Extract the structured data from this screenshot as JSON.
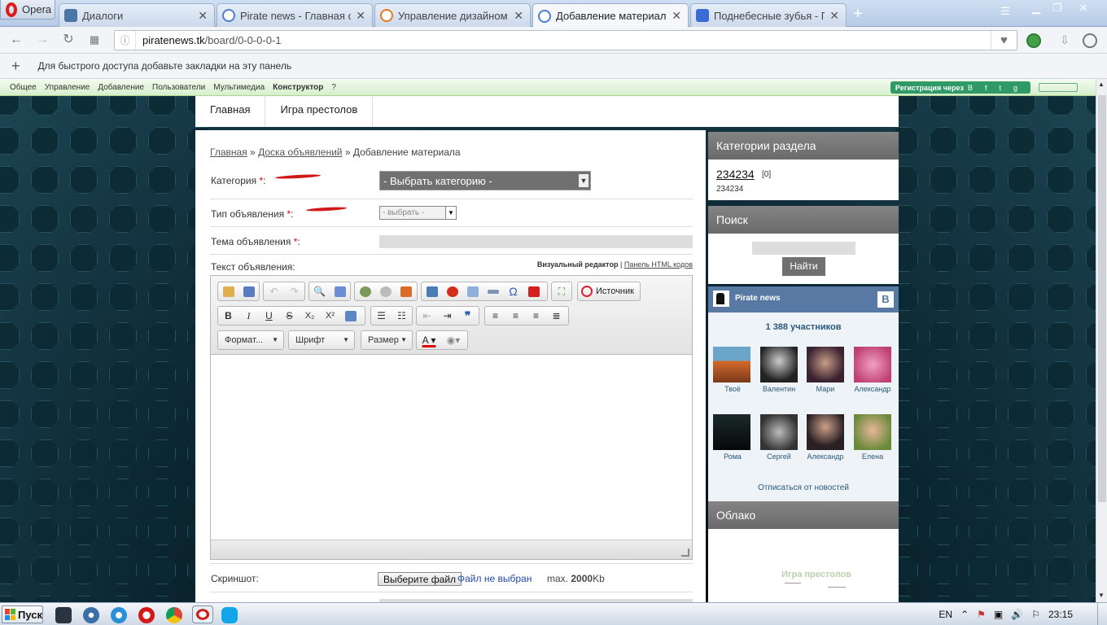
{
  "browser": {
    "menu_label": "Opera",
    "tabs": [
      {
        "title": "Диалоги",
        "active": false
      },
      {
        "title": "Pirate news - Главная стр",
        "active": false
      },
      {
        "title": "Управление дизайном - Г",
        "active": false
      },
      {
        "title": "Добавление материала -",
        "active": true
      },
      {
        "title": "Поднебесные зубья - По",
        "active": false
      }
    ],
    "url_host": "piratenews.tk",
    "url_path": "/board/0-0-0-0-1",
    "bookmarks_hint": "Для быстрого доступа добавьте закладки на эту панель"
  },
  "ucoz_panel": {
    "items": [
      "Общее",
      "Управление",
      "Добавление",
      "Пользователи",
      "Мультимедиа",
      "Конструктор",
      "?"
    ],
    "register_label": "Регистрация через"
  },
  "site_nav": [
    "Главная",
    "Игра престолов"
  ],
  "breadcrumb": {
    "home": "Главная",
    "sep": "»",
    "board": "Доска объявлений",
    "current": "Добавление материала"
  },
  "form": {
    "category_label": "Категория",
    "category_value": "- Выбрать категорию -",
    "type_label": "Тип объявления",
    "type_value": "- выбрать -",
    "topic_label": "Тема объявления",
    "text_label": "Текст объявления:",
    "visual_editor": "Визуальный редактор",
    "editor_sep": "|",
    "html_panel": "Панель HTML кодов",
    "source_label": "Источник",
    "format_label": "Формат...",
    "font_label": "Шрифт",
    "size_label": "Размер",
    "screenshot_label": "Скриншот:",
    "file_button": "Выберите файл",
    "file_status": "Файл не выбран",
    "max_prefix": "max.",
    "max_value": "2000",
    "max_unit": "Kb",
    "required_mark": "*",
    "colon": ":"
  },
  "sidebar": {
    "categories_title": "Категории раздела",
    "category_link": "234234",
    "category_count": "[0]",
    "category_sub": "234234",
    "search_title": "Поиск",
    "search_button": "Найти",
    "vk_group": "Pirate news",
    "vk_letter": "B",
    "vk_members": "1 388 участников",
    "vk_people": [
      "Твоё",
      "Валентин",
      "Мари",
      "Александр",
      "Рома",
      "Сергей",
      "Александр",
      "Елена"
    ],
    "vk_unsubscribe": "Отписаться от новостей",
    "cloud_title": "Облако",
    "cloud_tag": "Игра престолов"
  },
  "taskbar": {
    "start_label": "Пуск",
    "lang": "EN",
    "time": "23:15"
  }
}
